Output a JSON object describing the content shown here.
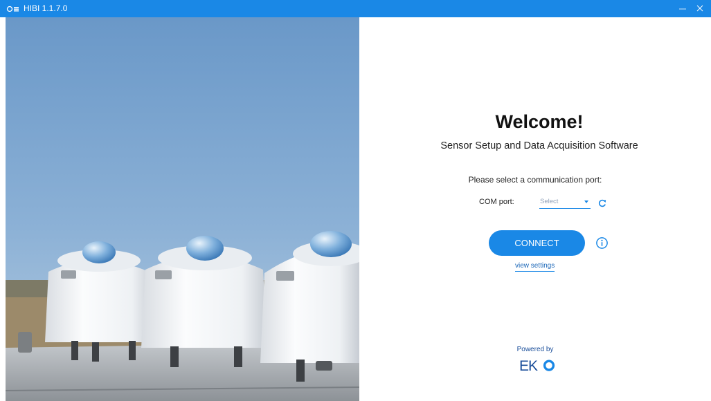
{
  "window": {
    "title": "HIBI 1.1.7.0"
  },
  "welcome": {
    "heading": "Welcome!",
    "subtitle": "Sensor Setup and Data Acquisition Software",
    "port_prompt": "Please select a communication port:"
  },
  "com_port": {
    "label": "COM port:",
    "placeholder": "Select"
  },
  "actions": {
    "connect_label": "CONNECT",
    "view_settings_label": "view settings"
  },
  "footer": {
    "powered_by": "Powered by",
    "brand_logo_text": "EKO"
  },
  "icons": {
    "app": "app-logo-icon",
    "minimize": "minimize-icon",
    "close": "close-icon",
    "dropdown": "chevron-down-icon",
    "refresh": "refresh-icon",
    "info": "info-icon"
  },
  "colors": {
    "accent": "#1a88e6",
    "titlebar": "#1a88e6",
    "brand_text": "#1a4e9a"
  }
}
